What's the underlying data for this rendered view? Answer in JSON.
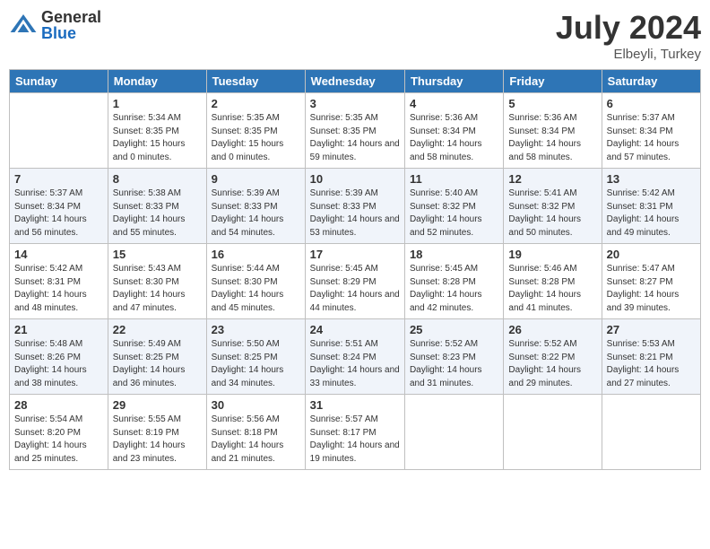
{
  "header": {
    "logo_general": "General",
    "logo_blue": "Blue",
    "month_year": "July 2024",
    "location": "Elbeyli, Turkey"
  },
  "days_of_week": [
    "Sunday",
    "Monday",
    "Tuesday",
    "Wednesday",
    "Thursday",
    "Friday",
    "Saturday"
  ],
  "weeks": [
    [
      null,
      {
        "day": 1,
        "sunrise": "Sunrise: 5:34 AM",
        "sunset": "Sunset: 8:35 PM",
        "daylight": "Daylight: 15 hours and 0 minutes."
      },
      {
        "day": 2,
        "sunrise": "Sunrise: 5:35 AM",
        "sunset": "Sunset: 8:35 PM",
        "daylight": "Daylight: 15 hours and 0 minutes."
      },
      {
        "day": 3,
        "sunrise": "Sunrise: 5:35 AM",
        "sunset": "Sunset: 8:35 PM",
        "daylight": "Daylight: 14 hours and 59 minutes."
      },
      {
        "day": 4,
        "sunrise": "Sunrise: 5:36 AM",
        "sunset": "Sunset: 8:34 PM",
        "daylight": "Daylight: 14 hours and 58 minutes."
      },
      {
        "day": 5,
        "sunrise": "Sunrise: 5:36 AM",
        "sunset": "Sunset: 8:34 PM",
        "daylight": "Daylight: 14 hours and 58 minutes."
      },
      {
        "day": 6,
        "sunrise": "Sunrise: 5:37 AM",
        "sunset": "Sunset: 8:34 PM",
        "daylight": "Daylight: 14 hours and 57 minutes."
      }
    ],
    [
      {
        "day": 7,
        "sunrise": "Sunrise: 5:37 AM",
        "sunset": "Sunset: 8:34 PM",
        "daylight": "Daylight: 14 hours and 56 minutes."
      },
      {
        "day": 8,
        "sunrise": "Sunrise: 5:38 AM",
        "sunset": "Sunset: 8:33 PM",
        "daylight": "Daylight: 14 hours and 55 minutes."
      },
      {
        "day": 9,
        "sunrise": "Sunrise: 5:39 AM",
        "sunset": "Sunset: 8:33 PM",
        "daylight": "Daylight: 14 hours and 54 minutes."
      },
      {
        "day": 10,
        "sunrise": "Sunrise: 5:39 AM",
        "sunset": "Sunset: 8:33 PM",
        "daylight": "Daylight: 14 hours and 53 minutes."
      },
      {
        "day": 11,
        "sunrise": "Sunrise: 5:40 AM",
        "sunset": "Sunset: 8:32 PM",
        "daylight": "Daylight: 14 hours and 52 minutes."
      },
      {
        "day": 12,
        "sunrise": "Sunrise: 5:41 AM",
        "sunset": "Sunset: 8:32 PM",
        "daylight": "Daylight: 14 hours and 50 minutes."
      },
      {
        "day": 13,
        "sunrise": "Sunrise: 5:42 AM",
        "sunset": "Sunset: 8:31 PM",
        "daylight": "Daylight: 14 hours and 49 minutes."
      }
    ],
    [
      {
        "day": 14,
        "sunrise": "Sunrise: 5:42 AM",
        "sunset": "Sunset: 8:31 PM",
        "daylight": "Daylight: 14 hours and 48 minutes."
      },
      {
        "day": 15,
        "sunrise": "Sunrise: 5:43 AM",
        "sunset": "Sunset: 8:30 PM",
        "daylight": "Daylight: 14 hours and 47 minutes."
      },
      {
        "day": 16,
        "sunrise": "Sunrise: 5:44 AM",
        "sunset": "Sunset: 8:30 PM",
        "daylight": "Daylight: 14 hours and 45 minutes."
      },
      {
        "day": 17,
        "sunrise": "Sunrise: 5:45 AM",
        "sunset": "Sunset: 8:29 PM",
        "daylight": "Daylight: 14 hours and 44 minutes."
      },
      {
        "day": 18,
        "sunrise": "Sunrise: 5:45 AM",
        "sunset": "Sunset: 8:28 PM",
        "daylight": "Daylight: 14 hours and 42 minutes."
      },
      {
        "day": 19,
        "sunrise": "Sunrise: 5:46 AM",
        "sunset": "Sunset: 8:28 PM",
        "daylight": "Daylight: 14 hours and 41 minutes."
      },
      {
        "day": 20,
        "sunrise": "Sunrise: 5:47 AM",
        "sunset": "Sunset: 8:27 PM",
        "daylight": "Daylight: 14 hours and 39 minutes."
      }
    ],
    [
      {
        "day": 21,
        "sunrise": "Sunrise: 5:48 AM",
        "sunset": "Sunset: 8:26 PM",
        "daylight": "Daylight: 14 hours and 38 minutes."
      },
      {
        "day": 22,
        "sunrise": "Sunrise: 5:49 AM",
        "sunset": "Sunset: 8:25 PM",
        "daylight": "Daylight: 14 hours and 36 minutes."
      },
      {
        "day": 23,
        "sunrise": "Sunrise: 5:50 AM",
        "sunset": "Sunset: 8:25 PM",
        "daylight": "Daylight: 14 hours and 34 minutes."
      },
      {
        "day": 24,
        "sunrise": "Sunrise: 5:51 AM",
        "sunset": "Sunset: 8:24 PM",
        "daylight": "Daylight: 14 hours and 33 minutes."
      },
      {
        "day": 25,
        "sunrise": "Sunrise: 5:52 AM",
        "sunset": "Sunset: 8:23 PM",
        "daylight": "Daylight: 14 hours and 31 minutes."
      },
      {
        "day": 26,
        "sunrise": "Sunrise: 5:52 AM",
        "sunset": "Sunset: 8:22 PM",
        "daylight": "Daylight: 14 hours and 29 minutes."
      },
      {
        "day": 27,
        "sunrise": "Sunrise: 5:53 AM",
        "sunset": "Sunset: 8:21 PM",
        "daylight": "Daylight: 14 hours and 27 minutes."
      }
    ],
    [
      {
        "day": 28,
        "sunrise": "Sunrise: 5:54 AM",
        "sunset": "Sunset: 8:20 PM",
        "daylight": "Daylight: 14 hours and 25 minutes."
      },
      {
        "day": 29,
        "sunrise": "Sunrise: 5:55 AM",
        "sunset": "Sunset: 8:19 PM",
        "daylight": "Daylight: 14 hours and 23 minutes."
      },
      {
        "day": 30,
        "sunrise": "Sunrise: 5:56 AM",
        "sunset": "Sunset: 8:18 PM",
        "daylight": "Daylight: 14 hours and 21 minutes."
      },
      {
        "day": 31,
        "sunrise": "Sunrise: 5:57 AM",
        "sunset": "Sunset: 8:17 PM",
        "daylight": "Daylight: 14 hours and 19 minutes."
      },
      null,
      null,
      null
    ]
  ]
}
